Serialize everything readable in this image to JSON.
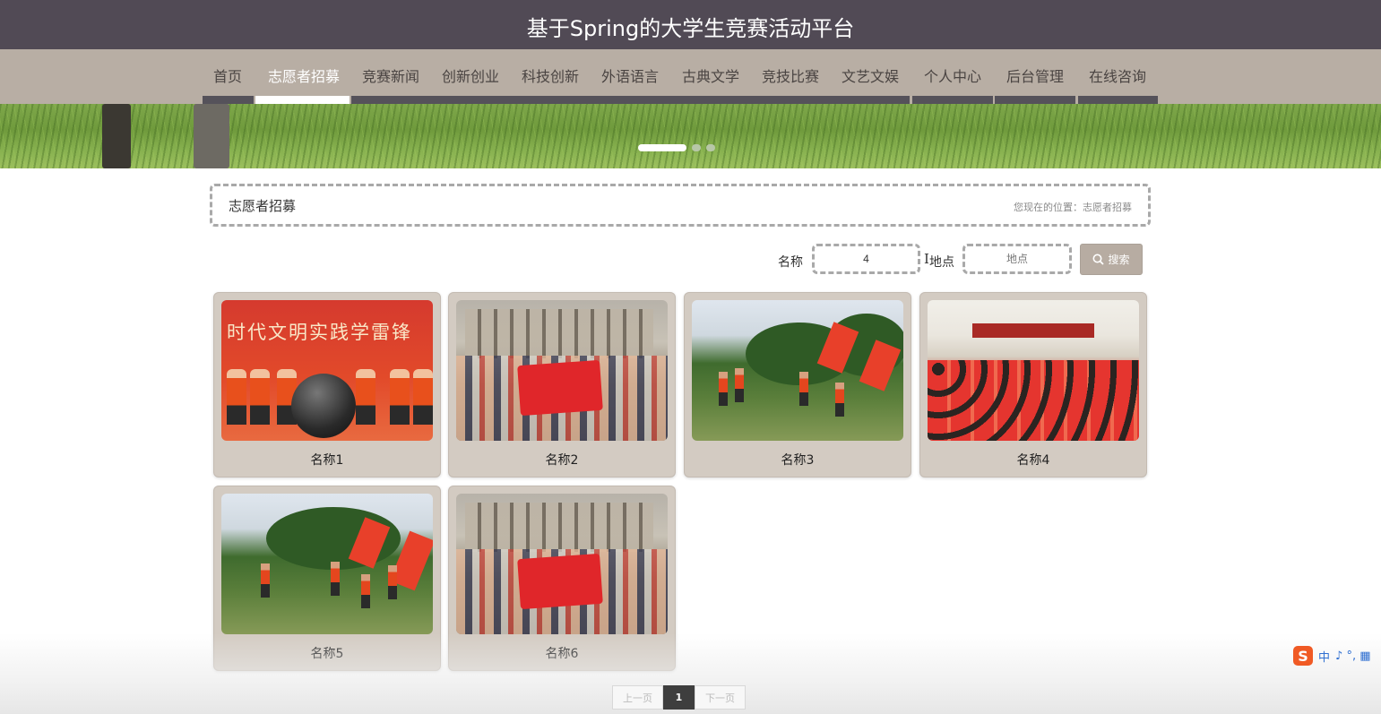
{
  "header": {
    "title": "基于Spring的大学生竞赛活动平台"
  },
  "nav": {
    "items": [
      {
        "label": "首页",
        "active": false
      },
      {
        "label": "志愿者招募",
        "active": true
      },
      {
        "label": "竞赛新闻",
        "active": false
      },
      {
        "label": "创新创业",
        "active": false
      },
      {
        "label": "科技创新",
        "active": false
      },
      {
        "label": "外语语言",
        "active": false
      },
      {
        "label": "古典文学",
        "active": false
      },
      {
        "label": "竞技比赛",
        "active": false
      },
      {
        "label": "文艺文娱",
        "active": false
      },
      {
        "label": "个人中心",
        "active": false
      },
      {
        "label": "后台管理",
        "active": false
      },
      {
        "label": "在线咨询",
        "active": false
      }
    ]
  },
  "carousel": {
    "slide_count": 3,
    "active_index": 0
  },
  "section": {
    "title": "志愿者招募",
    "breadcrumb": "您现在的位置：志愿者招募"
  },
  "search": {
    "name_label": "名称",
    "name_value": "4",
    "location_label": "地点",
    "location_placeholder": "地点",
    "button_label": "搜索",
    "button_icon": "search-icon"
  },
  "items": [
    {
      "caption": "名称1",
      "image": "volunteer-ceremony-photo",
      "banner_text": "时代文明实践学雷锋"
    },
    {
      "caption": "名称2",
      "image": "volunteer-group-photo"
    },
    {
      "caption": "名称3",
      "image": "volunteer-park-cleanup-photo"
    },
    {
      "caption": "名称4",
      "image": "volunteer-hall-meeting-photo"
    },
    {
      "caption": "名称5",
      "image": "volunteer-park-cleanup-photo"
    },
    {
      "caption": "名称6",
      "image": "volunteer-group-photo"
    }
  ],
  "pagination": {
    "prev_label": "上一页",
    "current": "1",
    "next_label": "下一页"
  },
  "ime": {
    "label": "中",
    "extra": "♪ °, ▦"
  },
  "colors": {
    "header_bg": "#514a55",
    "nav_bg": "#b8aea4",
    "card_bg": "#d3cbc2",
    "button_bg": "#b7aca2"
  }
}
